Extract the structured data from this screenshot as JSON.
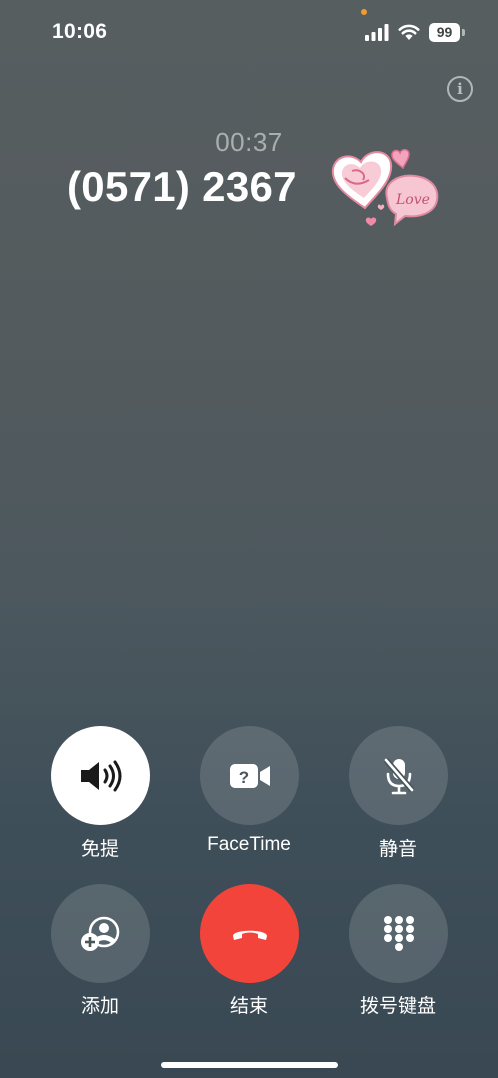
{
  "status_bar": {
    "time": "10:06",
    "battery": "99",
    "icons": [
      "signal-icon",
      "wifi-icon",
      "battery-icon"
    ]
  },
  "info": {
    "icon": "info-icon",
    "glyph": "i"
  },
  "call": {
    "timer": "00:37",
    "number": "(0571) 2367",
    "sticker": "love-hearts-sticker"
  },
  "controls": [
    {
      "label": "免提",
      "icon": "speaker-icon",
      "active": true
    },
    {
      "label": "FaceTime",
      "icon": "facetime-video-icon",
      "active": false
    },
    {
      "label": "静音",
      "icon": "mute-mic-icon",
      "active": false
    },
    {
      "label": "添加",
      "icon": "add-call-icon",
      "active": false
    },
    {
      "label": "结束",
      "icon": "end-call-icon",
      "active": false
    },
    {
      "label": "拨号键盘",
      "icon": "keypad-icon",
      "active": false
    }
  ],
  "colors": {
    "end_call": "#f2443a",
    "privacy_dot": "#f29b2e",
    "background_top": "#575e60",
    "background_bottom": "#394852"
  }
}
